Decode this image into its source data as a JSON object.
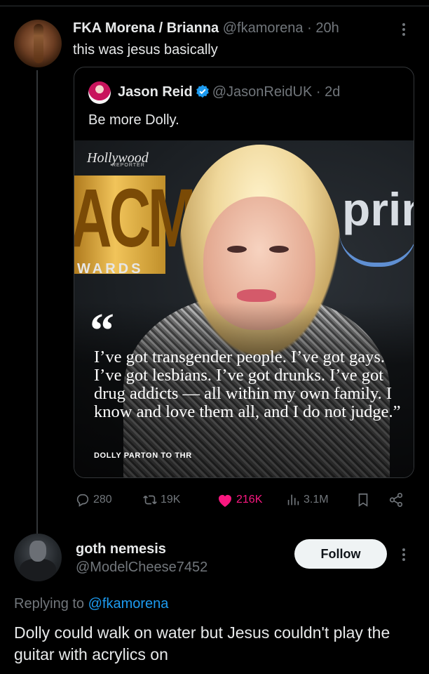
{
  "tweet": {
    "display_name": "FKA Morena / Brianna",
    "handle": "@fkamorena",
    "time": "· 20h",
    "text": "this was jesus basically"
  },
  "quoted": {
    "display_name": "Jason Reid",
    "handle": "@JasonReidUK",
    "time": "· 2d",
    "text": "Be more Dolly.",
    "image": {
      "thr_logo": "Hollywood",
      "thr_sub": "REPORTER",
      "acm": "ACM",
      "acm_sub": "WARDS",
      "prime": "prin",
      "quote_mark": "“",
      "quote": "I’ve got transgender people. I’ve got gays. I’ve got lesbians. I’ve got drunks. I’ve got drug addicts — all within my own family. I know and love them all, and I do not judge.”",
      "credit": "DOLLY PARTON TO THR"
    }
  },
  "actions": {
    "replies": "280",
    "reposts": "19K",
    "likes": "216K",
    "views": "3.1M"
  },
  "reply": {
    "display_name": "goth nemesis",
    "handle": "@ModelCheese7452",
    "follow_label": "Follow",
    "replying_prefix": "Replying to",
    "replying_to": "@fkamorena",
    "text": "Dolly could walk on water but Jesus couldn't play the guitar with acrylics on"
  },
  "colors": {
    "like": "#f91880",
    "link": "#1d9bf0",
    "muted": "#71767b",
    "verified": "#1d9bf0"
  }
}
